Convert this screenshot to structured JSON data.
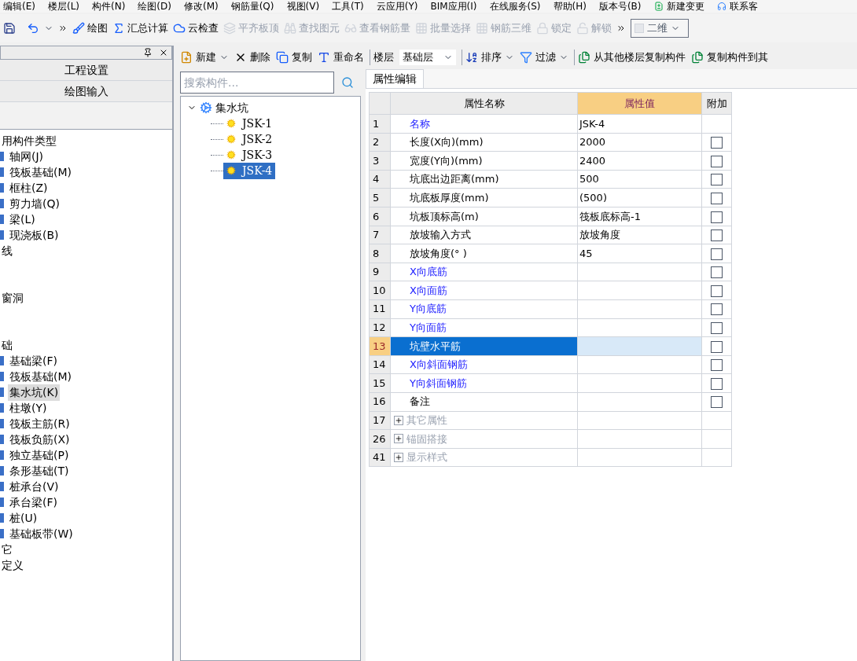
{
  "menu": [
    "编辑(E)",
    "楼层(L)",
    "构件(N)",
    "绘图(D)",
    "修改(M)",
    "钢筋量(Q)",
    "视图(V)",
    "工具(T)",
    "云应用(Y)",
    "BIM应用(I)",
    "在线服务(S)",
    "帮助(H)",
    "版本号(B)"
  ],
  "menu_extra": {
    "new_change": "新建变更",
    "contact": "联系客"
  },
  "toolbar": [
    {
      "label": "绘图",
      "disabled": false
    },
    {
      "label": "汇总计算",
      "disabled": false
    },
    {
      "label": "云检查",
      "disabled": false
    },
    {
      "label": "平齐板顶",
      "disabled": true
    },
    {
      "label": "查找图元",
      "disabled": true
    },
    {
      "label": "查看钢筋量",
      "disabled": true
    },
    {
      "label": "批量选择",
      "disabled": true
    },
    {
      "label": "钢筋三维",
      "disabled": true
    },
    {
      "label": "锁定",
      "disabled": true
    },
    {
      "label": "解锁",
      "disabled": true
    }
  ],
  "view_mode": "二维",
  "left_panel": {
    "buttons": [
      "工程设置",
      "绘图输入"
    ],
    "tree": [
      {
        "label": "用构件类型",
        "kind": "group",
        "selected": false
      },
      {
        "label": "轴网(J)",
        "kind": "item",
        "selected": false
      },
      {
        "label": "筏板基础(M)",
        "kind": "item",
        "selected": false
      },
      {
        "label": "框柱(Z)",
        "kind": "item",
        "selected": false
      },
      {
        "label": "剪力墙(Q)",
        "kind": "item",
        "selected": false
      },
      {
        "label": "梁(L)",
        "kind": "item",
        "selected": false
      },
      {
        "label": "现浇板(B)",
        "kind": "item",
        "selected": false
      },
      {
        "label": "线",
        "kind": "group",
        "selected": false
      },
      {
        "kind": "blank"
      },
      {
        "kind": "blank"
      },
      {
        "label": "窗洞",
        "kind": "group",
        "selected": false
      },
      {
        "kind": "blank"
      },
      {
        "kind": "blank"
      },
      {
        "label": "础",
        "kind": "group",
        "selected": false
      },
      {
        "label": "基础梁(F)",
        "kind": "item",
        "selected": false
      },
      {
        "label": "筏板基础(M)",
        "kind": "item",
        "selected": false
      },
      {
        "label": "集水坑(K)",
        "kind": "item",
        "selected": true
      },
      {
        "label": "柱墩(Y)",
        "kind": "item",
        "selected": false
      },
      {
        "label": "筏板主筋(R)",
        "kind": "item",
        "selected": false
      },
      {
        "label": "筏板负筋(X)",
        "kind": "item",
        "selected": false
      },
      {
        "label": "独立基础(P)",
        "kind": "item",
        "selected": false
      },
      {
        "label": "条形基础(T)",
        "kind": "item",
        "selected": false
      },
      {
        "label": "桩承台(V)",
        "kind": "item",
        "selected": false
      },
      {
        "label": "承台梁(F)",
        "kind": "item",
        "selected": false
      },
      {
        "label": "桩(U)",
        "kind": "item",
        "selected": false
      },
      {
        "label": "基础板带(W)",
        "kind": "item",
        "selected": false
      },
      {
        "label": "它",
        "kind": "group",
        "selected": false
      },
      {
        "label": "定义",
        "kind": "group",
        "selected": false
      }
    ]
  },
  "component_toolbar": {
    "new": "新建",
    "delete": "删除",
    "copy": "复制",
    "rename": "重命名",
    "floor_label": "楼层",
    "floor": "基础层",
    "sort": "排序",
    "filter": "过滤",
    "copy_from": "从其他楼层复制构件",
    "copy_to": "复制构件到其"
  },
  "component_panel": {
    "search_placeholder": "搜索构件...",
    "root": {
      "label": "集水坑",
      "expanded": true,
      "children": [
        {
          "label": "JSK-1",
          "selected": false
        },
        {
          "label": "JSK-2",
          "selected": false
        },
        {
          "label": "JSK-3",
          "selected": false
        },
        {
          "label": "JSK-4",
          "selected": true
        }
      ]
    }
  },
  "properties": {
    "tab": "属性编辑",
    "columns": [
      "属性名称",
      "属性值",
      "附加"
    ],
    "rows": [
      {
        "num": "1",
        "name": "名称",
        "value": "JSK-4",
        "kind": "blue",
        "selected": false
      },
      {
        "num": "2",
        "name": "长度(X向)(mm)",
        "value": "2000",
        "kind": "plain",
        "checked": false,
        "selected": false
      },
      {
        "num": "3",
        "name": "宽度(Y向)(mm)",
        "value": "2400",
        "kind": "plain",
        "checked": false,
        "selected": false
      },
      {
        "num": "4",
        "name": "坑底出边距离(mm)",
        "value": "500",
        "kind": "plain",
        "checked": false,
        "selected": false
      },
      {
        "num": "5",
        "name": "坑底板厚度(mm)",
        "value": "(500)",
        "kind": "plain",
        "checked": false,
        "selected": false
      },
      {
        "num": "6",
        "name": "坑板顶标高(m)",
        "value": "筏板底标高-1",
        "kind": "plain",
        "checked": false,
        "selected": false
      },
      {
        "num": "7",
        "name": "放坡输入方式",
        "value": "放坡角度",
        "kind": "plain",
        "checked": false,
        "selected": false
      },
      {
        "num": "8",
        "name": "放坡角度(° )",
        "value": "45",
        "kind": "plain",
        "checked": false,
        "selected": false
      },
      {
        "num": "9",
        "name": "X向底筋",
        "kind": "blue",
        "checked": false,
        "selected": false
      },
      {
        "num": "10",
        "name": "X向面筋",
        "kind": "blue",
        "checked": false,
        "selected": false
      },
      {
        "num": "11",
        "name": "Y向底筋",
        "kind": "blue",
        "checked": false,
        "selected": false
      },
      {
        "num": "12",
        "name": "Y向面筋",
        "kind": "blue",
        "checked": false,
        "selected": false
      },
      {
        "num": "13",
        "name": "坑壁水平筋",
        "kind": "blue",
        "checked": false,
        "selected": true
      },
      {
        "num": "14",
        "name": "X向斜面钢筋",
        "kind": "blue",
        "checked": false,
        "selected": false
      },
      {
        "num": "15",
        "name": "Y向斜面钢筋",
        "kind": "blue",
        "checked": false,
        "selected": false
      },
      {
        "num": "16",
        "name": "备注",
        "kind": "plain",
        "checked": false,
        "selected": false
      },
      {
        "num": "17",
        "name": "其它属性",
        "kind": "group",
        "selected": false
      },
      {
        "num": "26",
        "name": "锚固搭接",
        "kind": "group",
        "selected": false
      },
      {
        "num": "41",
        "name": "显示样式",
        "kind": "group",
        "selected": false
      }
    ]
  }
}
